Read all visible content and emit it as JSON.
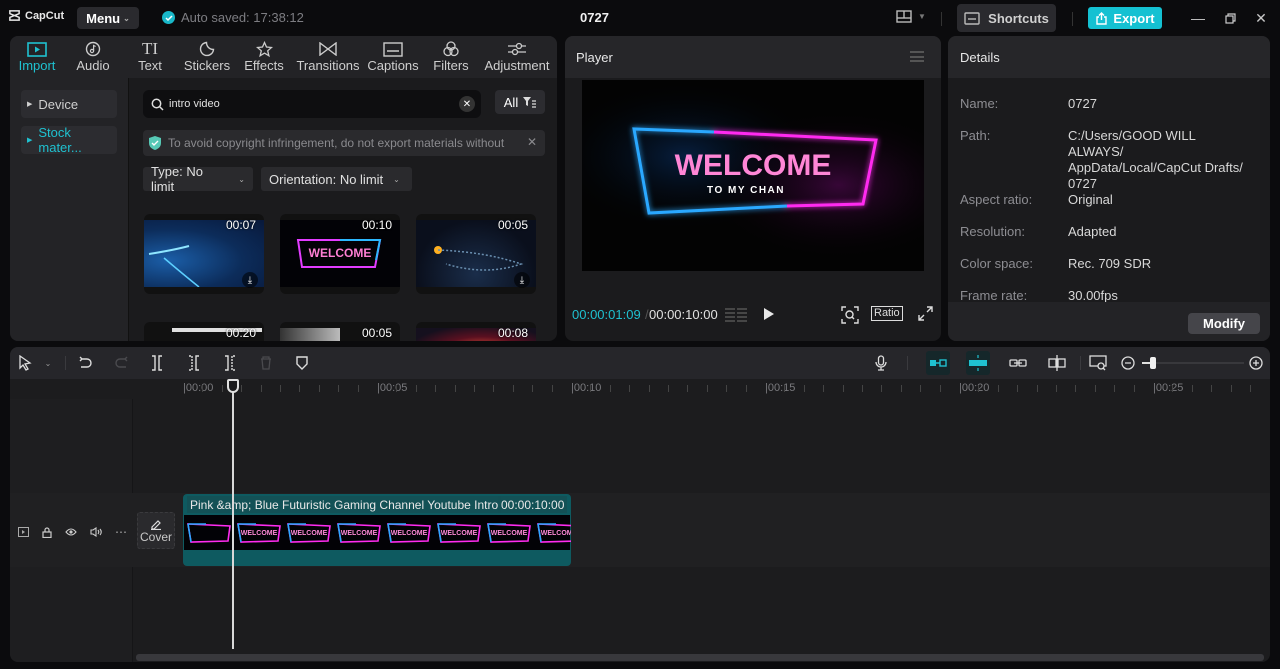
{
  "app": {
    "logo_text": "CapCut",
    "menu_label": "Menu",
    "autosave_text": "Auto saved: 17:38:12",
    "project_title": "0727",
    "shortcuts_label": "Shortcuts",
    "export_label": "Export",
    "accent_color": "#1fc1d0"
  },
  "media": {
    "tabs": [
      {
        "label": "Import",
        "icon": "import-icon",
        "active": true
      },
      {
        "label": "Audio",
        "icon": "audio-icon"
      },
      {
        "label": "Text",
        "icon": "text-icon"
      },
      {
        "label": "Stickers",
        "icon": "stickers-icon"
      },
      {
        "label": "Effects",
        "icon": "effects-icon"
      },
      {
        "label": "Transitions",
        "icon": "transitions-icon"
      },
      {
        "label": "Captions",
        "icon": "captions-icon"
      },
      {
        "label": "Filters",
        "icon": "filters-icon"
      },
      {
        "label": "Adjustment",
        "icon": "adjustment-icon"
      }
    ],
    "sidebar": [
      {
        "label": "Device"
      },
      {
        "label": "Stock mater...",
        "active": true
      }
    ],
    "search_value": "intro video",
    "all_label": "All",
    "notice": "To avoid copyright infringement, do not export materials without",
    "filters": [
      {
        "label": "Type: No limit"
      },
      {
        "label": "Orientation: No limit"
      }
    ],
    "thumbnails": [
      {
        "duration": "00:07",
        "download": true
      },
      {
        "duration": "00:10",
        "download": false
      },
      {
        "duration": "00:05",
        "download": true
      },
      {
        "duration": "00:20"
      },
      {
        "duration": "00:05"
      },
      {
        "duration": "00:08"
      }
    ]
  },
  "player": {
    "title": "Player",
    "preview_title": "WELCOME",
    "preview_subtitle": "TO MY CHAN",
    "current_time": "00:00:01:09",
    "separator": "/",
    "total_time": "00:00:10:00",
    "ratio_label": "Ratio"
  },
  "details": {
    "title": "Details",
    "rows": [
      {
        "key": "Name:",
        "value": "0727"
      },
      {
        "key": "Path:",
        "value": "C:/Users/GOOD WILL ALWAYS/ AppData/Local/CapCut Drafts/ 0727"
      },
      {
        "key": "Aspect ratio:",
        "value": "Original"
      },
      {
        "key": "Resolution:",
        "value": "Adapted"
      },
      {
        "key": "Color space:",
        "value": "Rec. 709 SDR"
      },
      {
        "key": "Frame rate:",
        "value": "30.00fps"
      }
    ],
    "modify_label": "Modify"
  },
  "timeline": {
    "ruler_labels": [
      "00:00",
      "00:05",
      "00:10",
      "00:15",
      "00:20",
      "00:25"
    ],
    "clip_title": "Pink &amp; Blue Futuristic Gaming Channel Youtube Intro",
    "clip_duration": "00:00:10:00",
    "cover_label": "Cover",
    "frame_text": "WELCOME",
    "zoom_level": 0.08
  }
}
